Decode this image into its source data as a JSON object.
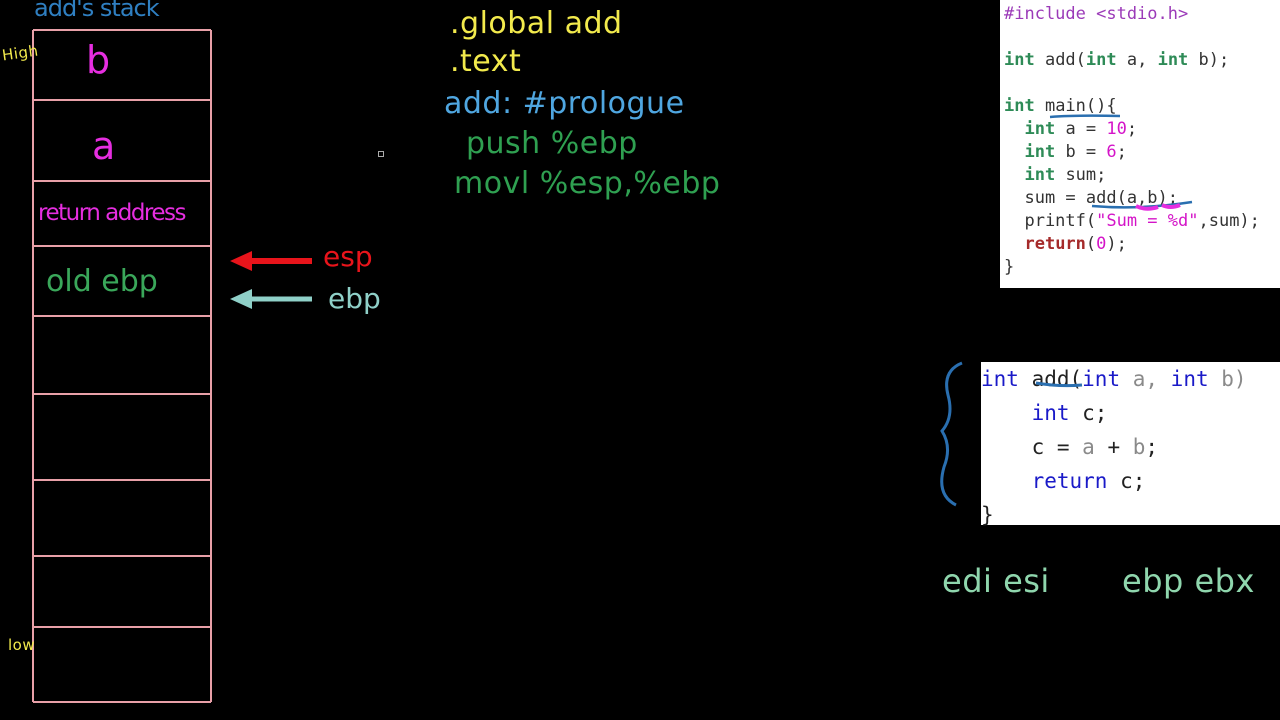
{
  "stack": {
    "title": "add's stack",
    "high_label": "High",
    "low_label": "low",
    "slots": [
      {
        "text": "b",
        "color": "#e62ee0"
      },
      {
        "text": "a",
        "color": "#e62ee0"
      },
      {
        "text": "return address",
        "color": "#e62ee0"
      },
      {
        "text": "old ebp",
        "color": "#3aa75a"
      },
      {
        "text": "",
        "color": ""
      },
      {
        "text": "",
        "color": ""
      },
      {
        "text": "",
        "color": ""
      },
      {
        "text": "",
        "color": ""
      },
      {
        "text": "",
        "color": ""
      }
    ],
    "border_color": "#e8a0a8"
  },
  "pointers": [
    {
      "label": "esp",
      "color": "#e8141b"
    },
    {
      "label": "ebp",
      "color": "#8fd0c8"
    }
  ],
  "notes": {
    "line1": ".global add",
    "line2": ".text",
    "line3": "add: #prologue",
    "line4": "push %ebp",
    "line5": "movl %esp,%ebp",
    "colors": {
      "directive": "#f2ea4c",
      "label": "#4fa6e0",
      "instr": "#2fa051"
    }
  },
  "code_main": {
    "lines": [
      [
        {
          "t": "#include <stdio.h>",
          "c": "pp"
        }
      ],
      [
        {
          "t": "",
          "c": "plain"
        }
      ],
      [
        {
          "t": "int",
          "c": "kw-green"
        },
        {
          "t": " add(",
          "c": "kw-dark"
        },
        {
          "t": "int",
          "c": "kw-green"
        },
        {
          "t": " a, ",
          "c": "kw-dark"
        },
        {
          "t": "int",
          "c": "kw-green"
        },
        {
          "t": " b);",
          "c": "kw-dark"
        }
      ],
      [
        {
          "t": "",
          "c": "plain"
        }
      ],
      [
        {
          "t": "int",
          "c": "kw-green"
        },
        {
          "t": " main(){",
          "c": "kw-dark"
        }
      ],
      [
        {
          "t": "  ",
          "c": "plain"
        },
        {
          "t": "int",
          "c": "kw-green"
        },
        {
          "t": " a = ",
          "c": "kw-dark"
        },
        {
          "t": "10",
          "c": "num"
        },
        {
          "t": ";",
          "c": "kw-dark"
        }
      ],
      [
        {
          "t": "  ",
          "c": "plain"
        },
        {
          "t": "int",
          "c": "kw-green"
        },
        {
          "t": " b = ",
          "c": "kw-dark"
        },
        {
          "t": "6",
          "c": "num"
        },
        {
          "t": ";",
          "c": "kw-dark"
        }
      ],
      [
        {
          "t": "  ",
          "c": "plain"
        },
        {
          "t": "int",
          "c": "kw-green"
        },
        {
          "t": " sum;",
          "c": "kw-dark"
        }
      ],
      [
        {
          "t": "  sum = add(a,b);",
          "c": "kw-dark"
        }
      ],
      [
        {
          "t": "  printf(",
          "c": "kw-dark"
        },
        {
          "t": "\"Sum = %d\"",
          "c": "str"
        },
        {
          "t": ",sum);",
          "c": "kw-dark"
        }
      ],
      [
        {
          "t": "  ",
          "c": "plain"
        },
        {
          "t": "return",
          "c": "ret"
        },
        {
          "t": "(",
          "c": "kw-dark"
        },
        {
          "t": "0",
          "c": "num"
        },
        {
          "t": ");",
          "c": "kw-dark"
        }
      ],
      [
        {
          "t": "}",
          "c": "kw-dark"
        }
      ]
    ]
  },
  "code_add": {
    "lines": [
      [
        {
          "t": "int",
          "c": "kw-blue"
        },
        {
          "t": " add(",
          "c": "plain"
        },
        {
          "t": "int",
          "c": "kw-blue"
        },
        {
          "t": " a, ",
          "c": "gray"
        },
        {
          "t": "int",
          "c": "kw-blue"
        },
        {
          "t": " b)",
          "c": "gray"
        }
      ],
      [
        {
          "t": "    ",
          "c": "plain"
        },
        {
          "t": "int",
          "c": "kw-blue"
        },
        {
          "t": " c;",
          "c": "plain"
        }
      ],
      [
        {
          "t": "    c = ",
          "c": "plain"
        },
        {
          "t": "a",
          "c": "gray"
        },
        {
          "t": " + ",
          "c": "plain"
        },
        {
          "t": "b",
          "c": "gray"
        },
        {
          "t": ";",
          "c": "plain"
        }
      ],
      [
        {
          "t": "    ",
          "c": "plain"
        },
        {
          "t": "return",
          "c": "kw-blue"
        },
        {
          "t": " c;",
          "c": "plain"
        }
      ],
      [
        {
          "t": "}",
          "c": "plain"
        }
      ]
    ]
  },
  "registers": {
    "group1": "edi esi",
    "group2": "ebp ebx",
    "color": "#8fd6ad"
  }
}
